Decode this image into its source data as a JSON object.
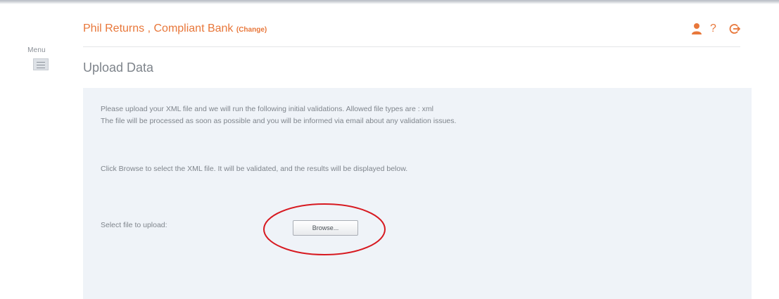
{
  "menu": {
    "label": "Menu"
  },
  "header": {
    "org_name": "Phil Returns , Compliant Bank ",
    "change_label": "(Change)",
    "icons": [
      "user-icon",
      "help-icon",
      "logout-icon"
    ],
    "help_glyph": "?"
  },
  "page": {
    "title": "Upload Data"
  },
  "instructions": {
    "line1": "Please upload your XML file and we will run the following initial validations. Allowed file types are : xml",
    "line2": "The file will be processed as soon as possible and you will be informed via email about any validation issues.",
    "line3": "Click Browse to select the XML file. It will be validated, and the results will be displayed below."
  },
  "upload": {
    "label": "Select file to upload:",
    "browse_label": "Browse..."
  },
  "colors": {
    "accent": "#e8773a",
    "panel": "#eff3f8",
    "annotation": "#d71920"
  }
}
